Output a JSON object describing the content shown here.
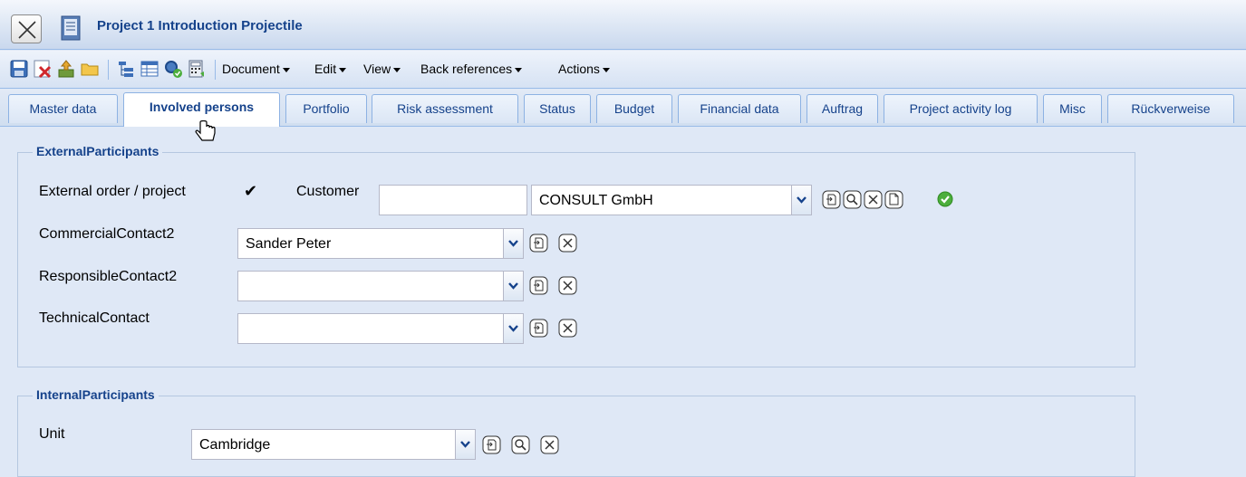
{
  "window": {
    "title": "Project 1 Introduction Projectile"
  },
  "toolbar": {
    "icons": [
      "save-icon",
      "delete-icon",
      "export-icon",
      "folder-icon",
      "tree-icon",
      "table-icon",
      "search-ok-icon",
      "calculator-icon"
    ],
    "menus": [
      {
        "label": "Document"
      },
      {
        "label": "Edit"
      },
      {
        "label": "View"
      },
      {
        "label": "Back references"
      },
      {
        "label": "Actions"
      }
    ]
  },
  "tabs": [
    {
      "label": "Master data"
    },
    {
      "label": "Involved persons",
      "active": true
    },
    {
      "label": "Portfolio"
    },
    {
      "label": "Risk assessment"
    },
    {
      "label": "Status"
    },
    {
      "label": "Budget"
    },
    {
      "label": "Financial data"
    },
    {
      "label": "Auftrag"
    },
    {
      "label": "Project activity log"
    },
    {
      "label": "Misc"
    },
    {
      "label": "Rückverweise"
    }
  ],
  "external": {
    "legend": "ExternalParticipants",
    "external_order_label": "External order / project",
    "external_order_checked": true,
    "customer_label": "Customer",
    "customer_code": "",
    "customer_value": "CONSULT GmbH",
    "commercial_label": "CommercialContact2",
    "commercial_value": "Sander Peter",
    "responsible_label": "ResponsibleContact2",
    "responsible_value": "",
    "technical_label": "TechnicalContact",
    "technical_value": ""
  },
  "internal": {
    "legend": "InternalParticipants",
    "unit_label": "Unit",
    "unit_value": "Cambridge"
  },
  "colors": {
    "background": "#dfe8f6",
    "accent": "#15428b",
    "border": "#99bbe8",
    "ok_green": "#4cae3c"
  }
}
